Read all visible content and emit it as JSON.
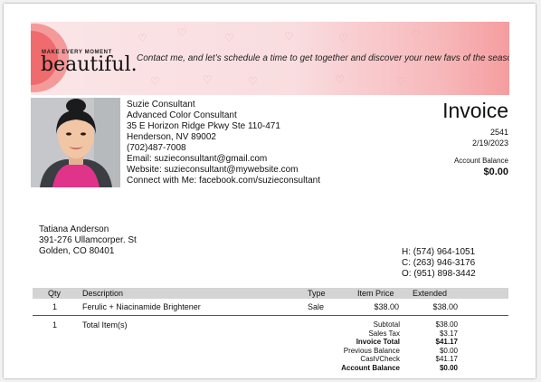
{
  "banner": {
    "brand_small": "MAKE EVERY MOMENT",
    "brand_big": "beautiful.",
    "tagline": "Contact me, and let’s schedule a time to get together and discover your new favs of the season."
  },
  "consultant": {
    "name": "Suzie Consultant",
    "title": "Advanced Color Consultant",
    "address1": "35 E Horizon Ridge Pkwy Ste 110-471",
    "address2": "Henderson, NV  89002",
    "phone": "(702)487-7008",
    "email": "Email: suzieconsultant@gmail.com",
    "website": "Website: suzieconsultant@mywebsite.com",
    "connect": "Connect with Me: facebook.com/suzieconsultant"
  },
  "invoice": {
    "title": "Invoice",
    "number": "2541",
    "date": "2/19/2023",
    "account_balance_label": "Account Balance",
    "account_balance_value": "$0.00"
  },
  "customer": {
    "name": "Tatiana Anderson",
    "address1": "391-276 Ullamcorper. St",
    "address2": "Golden, CO  80401",
    "phones": [
      "H: (574) 964-1051",
      "C: (263) 946-3176",
      "O: (951) 898-3442"
    ]
  },
  "table": {
    "headers": {
      "qty": "Qty",
      "description": "Description",
      "type": "Type",
      "item_price": "Item Price",
      "extended": "Extended"
    },
    "rows": [
      {
        "qty": "1",
        "description": "Ferulic + Niacinamide Brightener",
        "type": "Sale",
        "item_price": "$38.00",
        "extended": "$38.00"
      }
    ]
  },
  "totals": {
    "count": "1",
    "count_label": "Total Item(s)",
    "summary": [
      {
        "label": "Subtotal",
        "value": "$38.00",
        "bold": false
      },
      {
        "label": "Sales Tax",
        "value": "$3.17",
        "bold": false
      },
      {
        "label": "Invoice Total",
        "value": "$41.17",
        "bold": true
      },
      {
        "label": "Previous Balance",
        "value": "$0.00",
        "bold": false
      },
      {
        "label": "Cash/Check",
        "value": "$41.17",
        "bold": false
      },
      {
        "label": "Account Balance",
        "value": "$0.00",
        "bold": true
      }
    ]
  },
  "colors": {
    "banner_pink": "#f9dde0",
    "banner_coral": "#f59d9f",
    "header_gray": "#d4d4d4"
  }
}
